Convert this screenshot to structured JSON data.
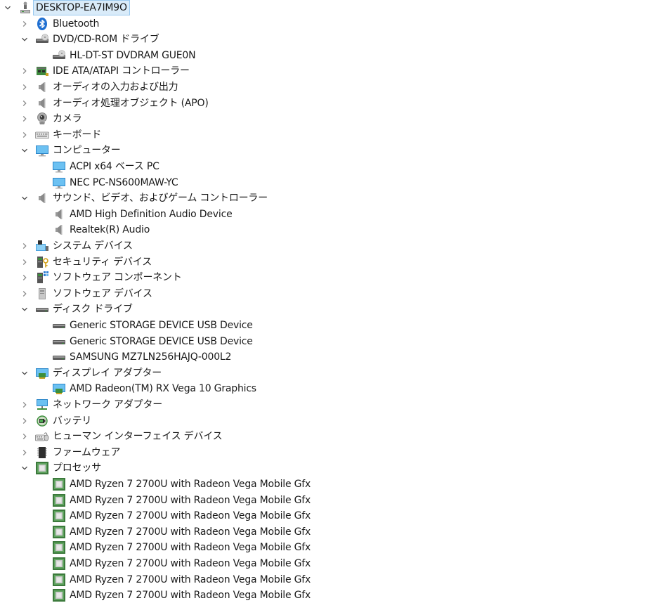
{
  "tree": [
    {
      "label": "DESKTOP-EA7IM9O",
      "depth": 0,
      "expander": "expanded",
      "icon": "computer-root-icon",
      "selected": true
    },
    {
      "label": "Bluetooth",
      "depth": 1,
      "expander": "collapsed",
      "icon": "bluetooth-icon"
    },
    {
      "label": "DVD/CD-ROM ドライブ",
      "depth": 1,
      "expander": "expanded",
      "icon": "optical-drive-icon"
    },
    {
      "label": "HL-DT-ST DVDRAM GUE0N",
      "depth": 2,
      "expander": "none",
      "icon": "optical-drive-icon"
    },
    {
      "label": "IDE ATA/ATAPI コントローラー",
      "depth": 1,
      "expander": "collapsed",
      "icon": "ide-controller-icon"
    },
    {
      "label": "オーディオの入力および出力",
      "depth": 1,
      "expander": "collapsed",
      "icon": "speaker-icon"
    },
    {
      "label": "オーディオ処理オブジェクト (APO)",
      "depth": 1,
      "expander": "collapsed",
      "icon": "speaker-icon"
    },
    {
      "label": "カメラ",
      "depth": 1,
      "expander": "collapsed",
      "icon": "camera-icon"
    },
    {
      "label": "キーボード",
      "depth": 1,
      "expander": "collapsed",
      "icon": "keyboard-icon"
    },
    {
      "label": "コンピューター",
      "depth": 1,
      "expander": "expanded",
      "icon": "monitor-icon"
    },
    {
      "label": "ACPI x64 ベース PC",
      "depth": 2,
      "expander": "none",
      "icon": "monitor-icon"
    },
    {
      "label": "NEC PC-NS600MAW-YC",
      "depth": 2,
      "expander": "none",
      "icon": "monitor-icon"
    },
    {
      "label": "サウンド、ビデオ、およびゲーム コントローラー",
      "depth": 1,
      "expander": "expanded",
      "icon": "speaker-icon"
    },
    {
      "label": "AMD High Definition Audio Device",
      "depth": 2,
      "expander": "none",
      "icon": "speaker-icon"
    },
    {
      "label": "Realtek(R) Audio",
      "depth": 2,
      "expander": "none",
      "icon": "speaker-icon"
    },
    {
      "label": "システム デバイス",
      "depth": 1,
      "expander": "collapsed",
      "icon": "system-device-icon"
    },
    {
      "label": "セキュリティ デバイス",
      "depth": 1,
      "expander": "collapsed",
      "icon": "security-device-icon"
    },
    {
      "label": "ソフトウェア コンポーネント",
      "depth": 1,
      "expander": "collapsed",
      "icon": "software-component-icon"
    },
    {
      "label": "ソフトウェア デバイス",
      "depth": 1,
      "expander": "collapsed",
      "icon": "software-device-icon"
    },
    {
      "label": "ディスク ドライブ",
      "depth": 1,
      "expander": "expanded",
      "icon": "disk-drive-icon"
    },
    {
      "label": "Generic STORAGE DEVICE USB Device",
      "depth": 2,
      "expander": "none",
      "icon": "disk-drive-icon"
    },
    {
      "label": "Generic STORAGE DEVICE USB Device",
      "depth": 2,
      "expander": "none",
      "icon": "disk-drive-icon"
    },
    {
      "label": "SAMSUNG MZ7LN256HAJQ-000L2",
      "depth": 2,
      "expander": "none",
      "icon": "disk-drive-icon"
    },
    {
      "label": "ディスプレイ アダプター",
      "depth": 1,
      "expander": "expanded",
      "icon": "display-adapter-icon"
    },
    {
      "label": "AMD Radeon(TM) RX Vega 10 Graphics",
      "depth": 2,
      "expander": "none",
      "icon": "display-adapter-icon"
    },
    {
      "label": "ネットワーク アダプター",
      "depth": 1,
      "expander": "collapsed",
      "icon": "network-adapter-icon"
    },
    {
      "label": "バッテリ",
      "depth": 1,
      "expander": "collapsed",
      "icon": "battery-icon"
    },
    {
      "label": "ヒューマン インターフェイス デバイス",
      "depth": 1,
      "expander": "collapsed",
      "icon": "hid-icon"
    },
    {
      "label": "ファームウェア",
      "depth": 1,
      "expander": "collapsed",
      "icon": "firmware-icon"
    },
    {
      "label": "プロセッサ",
      "depth": 1,
      "expander": "expanded",
      "icon": "processor-icon"
    },
    {
      "label": "AMD Ryzen 7 2700U with Radeon Vega Mobile Gfx",
      "depth": 2,
      "expander": "none",
      "icon": "processor-icon"
    },
    {
      "label": "AMD Ryzen 7 2700U with Radeon Vega Mobile Gfx",
      "depth": 2,
      "expander": "none",
      "icon": "processor-icon"
    },
    {
      "label": "AMD Ryzen 7 2700U with Radeon Vega Mobile Gfx",
      "depth": 2,
      "expander": "none",
      "icon": "processor-icon"
    },
    {
      "label": "AMD Ryzen 7 2700U with Radeon Vega Mobile Gfx",
      "depth": 2,
      "expander": "none",
      "icon": "processor-icon"
    },
    {
      "label": "AMD Ryzen 7 2700U with Radeon Vega Mobile Gfx",
      "depth": 2,
      "expander": "none",
      "icon": "processor-icon"
    },
    {
      "label": "AMD Ryzen 7 2700U with Radeon Vega Mobile Gfx",
      "depth": 2,
      "expander": "none",
      "icon": "processor-icon"
    },
    {
      "label": "AMD Ryzen 7 2700U with Radeon Vega Mobile Gfx",
      "depth": 2,
      "expander": "none",
      "icon": "processor-icon"
    },
    {
      "label": "AMD Ryzen 7 2700U with Radeon Vega Mobile Gfx",
      "depth": 2,
      "expander": "none",
      "icon": "processor-icon"
    }
  ],
  "colors": {
    "selection_bg": "#d9ebf9",
    "selection_border": "#99c9ef",
    "chevron": "#4a4a4a",
    "bluetooth": "#1f6fd1",
    "monitor": "#3aa0e0",
    "processor": "#3c7a3c"
  }
}
